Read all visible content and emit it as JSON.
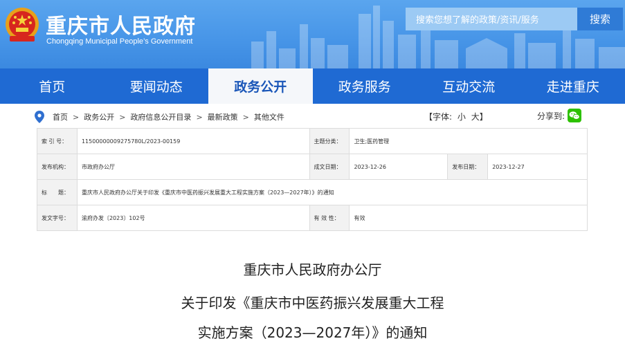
{
  "header": {
    "title": "重庆市人民政府",
    "subtitle": "Chongqing Municipal People’s Government",
    "search_placeholder": "搜索您想了解的政策/资讯/服务",
    "search_button": "搜索"
  },
  "nav": {
    "items": [
      {
        "label": "首页"
      },
      {
        "label": "要闻动态"
      },
      {
        "label": "政务公开"
      },
      {
        "label": "政务服务"
      },
      {
        "label": "互动交流"
      },
      {
        "label": "走进重庆"
      }
    ],
    "active": "政务公开"
  },
  "breadcrumb": {
    "items": [
      "首页",
      "政务公开",
      "政府信息公开目录",
      "最新政策",
      "其他文件"
    ],
    "separator": ">"
  },
  "font_size": {
    "label": "【字体:",
    "small": "小",
    "large": "大",
    "close": "】"
  },
  "share": {
    "label": "分享到:"
  },
  "info": {
    "index_label": "索 引 号：",
    "index_value": "11500000009275780L/2023-00159",
    "topic_label": "主题分类：",
    "topic_value": "卫生;医药管理",
    "issuer_label": "发布机构：",
    "issuer_value": "市政府办公厅",
    "created_label": "成文日期：",
    "created_value": "2023-12-26",
    "published_label": "发布日期：",
    "published_value": "2023-12-27",
    "title_label": "标　　题：",
    "title_value": "重庆市人民政府办公厅关于印发《重庆市中医药振兴发展重大工程实施方案（2023—2027年）》的通知",
    "docno_label": "发文字号：",
    "docno_value": "渝府办发〔2023〕102号",
    "validity_label": "有 效 性：",
    "validity_value": "有效"
  },
  "document": {
    "line1": "重庆市人民政府办公厅",
    "line2": "关于印发《重庆市中医药振兴发展重大工程",
    "line3": "实施方案（2023—2027年）》的通知"
  },
  "colors": {
    "header_blue": "#4896e8",
    "nav_blue": "#1f6ad3",
    "active_tab_text": "#1a56b8",
    "search_button": "#2f7bd6",
    "wechat_green": "#2dc100"
  }
}
